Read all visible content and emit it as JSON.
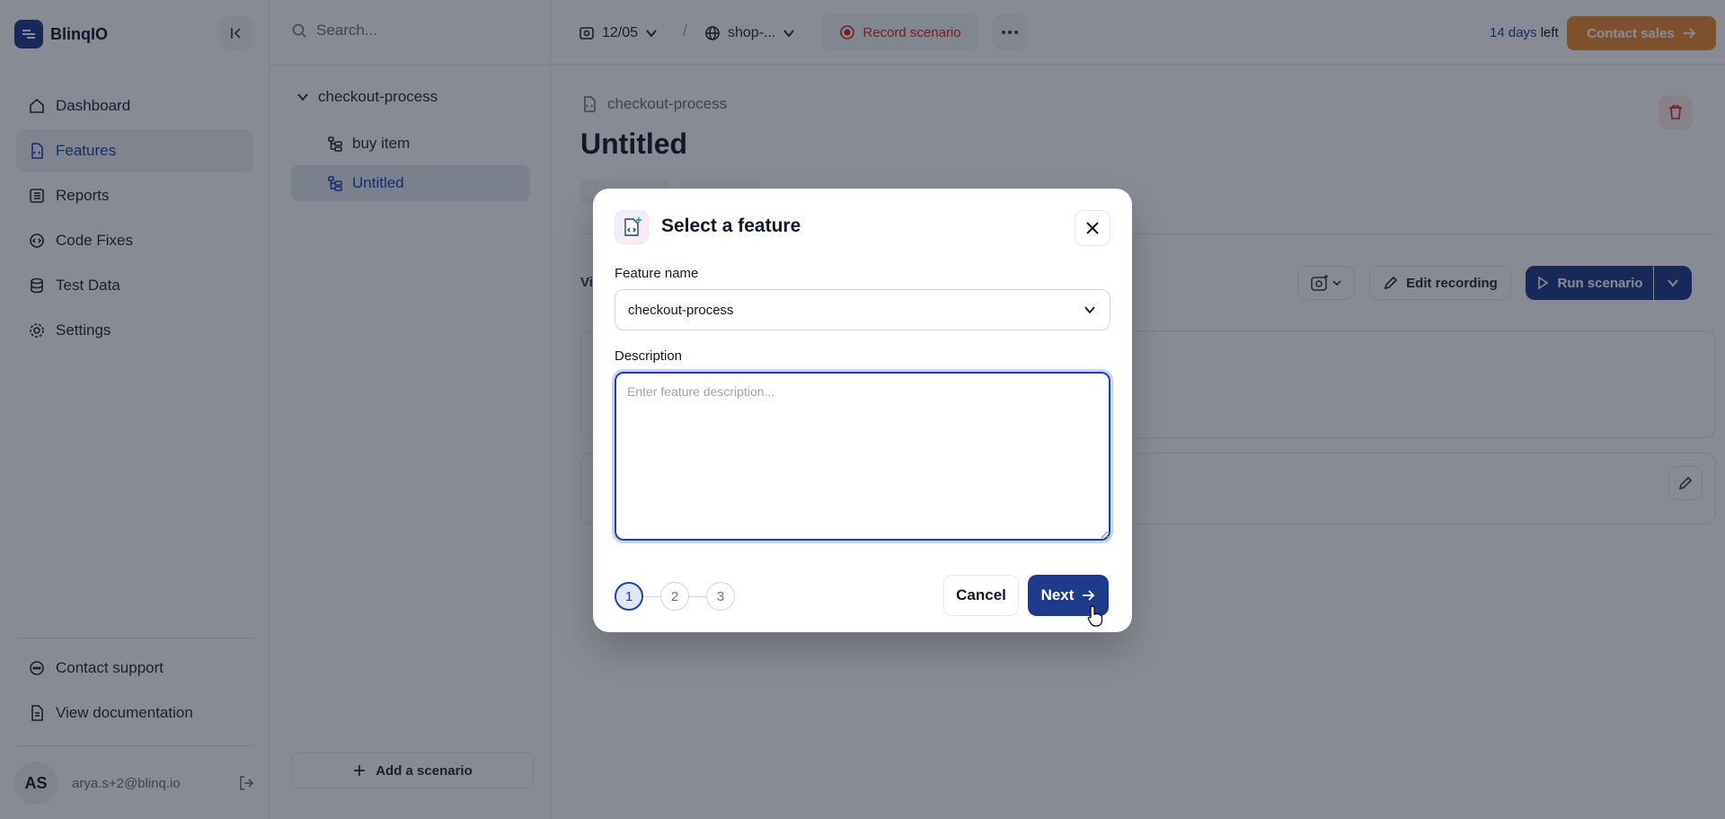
{
  "brand": {
    "name": "BlinqIO"
  },
  "sidebar": {
    "items": [
      {
        "label": "Dashboard",
        "icon": "home-icon"
      },
      {
        "label": "Features",
        "icon": "feature-icon",
        "active": true
      },
      {
        "label": "Reports",
        "icon": "list-icon"
      },
      {
        "label": "Code Fixes",
        "icon": "code-gear-icon"
      },
      {
        "label": "Test Data",
        "icon": "database-icon"
      },
      {
        "label": "Settings",
        "icon": "gear-icon"
      }
    ],
    "bottom_items": [
      {
        "label": "Contact support",
        "icon": "chat-icon"
      },
      {
        "label": "View documentation",
        "icon": "document-icon"
      }
    ],
    "user": {
      "initials": "AS",
      "email": "arya.s+2@blinq.io"
    }
  },
  "tree": {
    "search_placeholder": "Search...",
    "root": "checkout-process",
    "children": [
      {
        "label": "buy item"
      },
      {
        "label": "Untitled",
        "active": true
      }
    ],
    "add_scenario_label": "Add a scenario"
  },
  "topbar": {
    "version": "12/05",
    "environment": "shop-...",
    "record_label": "Record scenario",
    "trial_days": "14 days",
    "trial_suffix": "left",
    "contact_sales_label": "Contact sales"
  },
  "page": {
    "breadcrumb": "checkout-process",
    "title": "Untitled",
    "section_label": "Vi",
    "edit_recording_label": "Edit recording",
    "run_scenario_label": "Run scenario"
  },
  "modal": {
    "title": "Select a feature",
    "feature_name_label": "Feature name",
    "feature_name_value": "checkout-process",
    "description_label": "Description",
    "description_placeholder": "Enter feature description...",
    "steps": [
      "1",
      "2",
      "3"
    ],
    "current_step": 1,
    "cancel_label": "Cancel",
    "next_label": "Next"
  },
  "colors": {
    "primary": "#1e3a8a",
    "accent_orange": "#ea8a30",
    "record_red": "#dc2626"
  }
}
